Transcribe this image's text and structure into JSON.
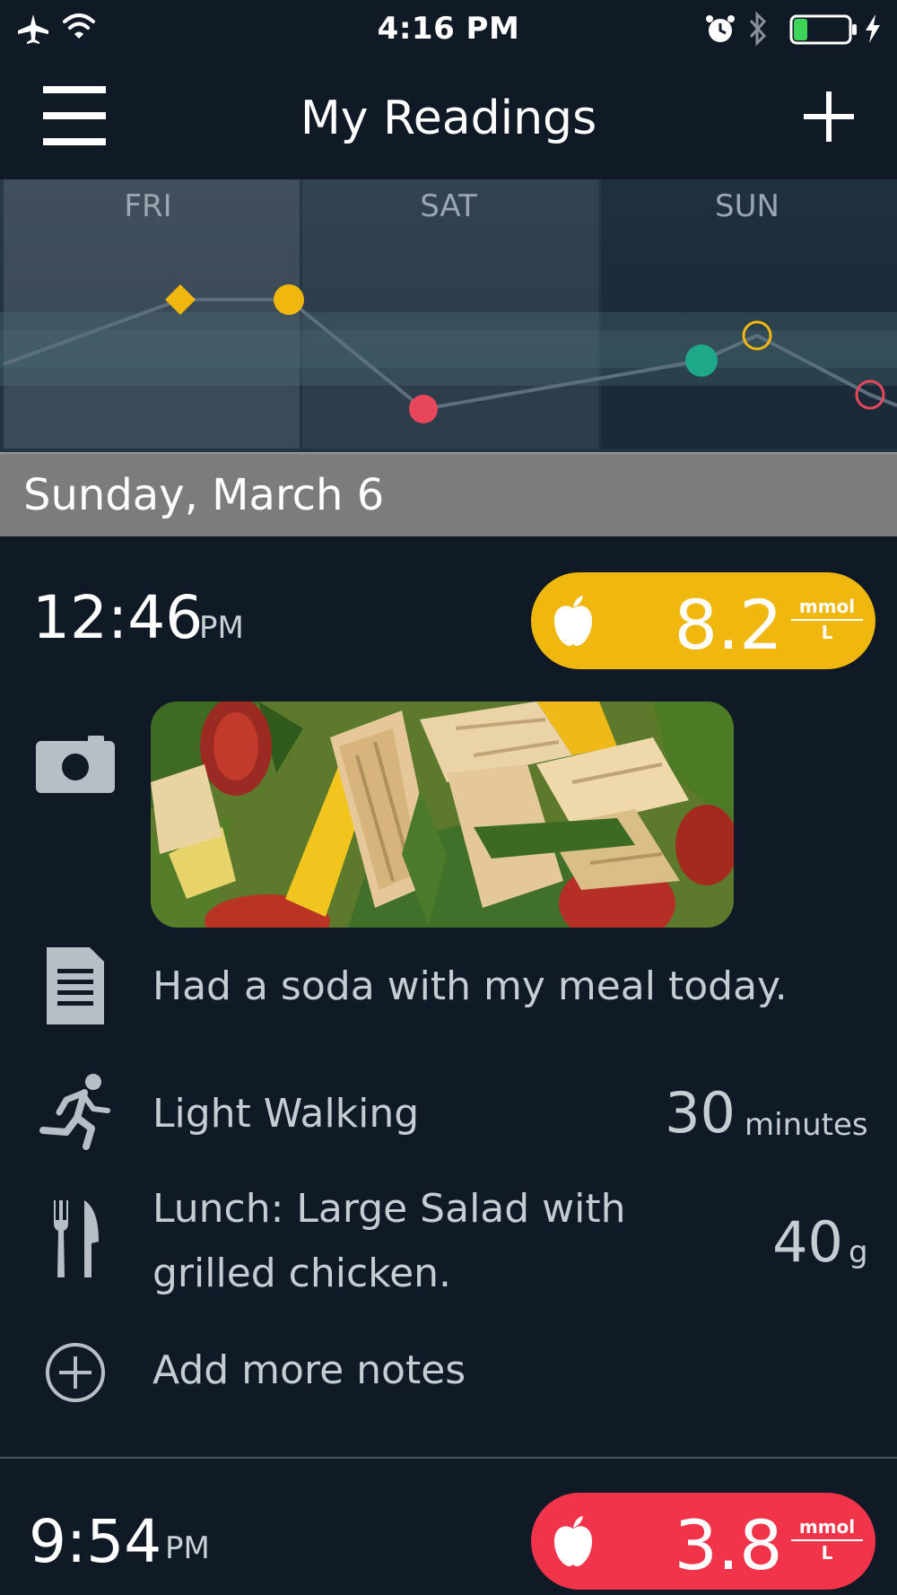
{
  "status_bar": {
    "time": "4:16 PM",
    "icons": [
      "airplane-icon",
      "wifi-icon",
      "alarm-icon",
      "bluetooth-icon",
      "battery-icon",
      "charging-bolt-icon"
    ],
    "battery_fill_fraction": 0.22
  },
  "nav": {
    "title": "My Readings",
    "menu_icon": "hamburger-menu-icon",
    "add_icon": "plus-icon"
  },
  "chart": {
    "days": [
      "FRI",
      "SAT",
      "SUN"
    ]
  },
  "date_header": "Sunday, March 6",
  "readings": [
    {
      "time": "12:46",
      "ampm": "PM",
      "badge_icon": "apple-icon",
      "value": "8.2",
      "unit_top": "mmol",
      "unit_bottom": "L",
      "color": "#f0b70e",
      "photo_icon": "camera-icon",
      "note_icon": "document-icon",
      "note": "Had a soda with my meal today.",
      "activity_icon": "running-icon",
      "activity": "Light Walking",
      "activity_value": "30",
      "activity_unit": "minutes",
      "meal_icon": "fork-knife-icon",
      "meal_line1": "Lunch: Large Salad with",
      "meal_line2": "grilled chicken.",
      "meal_value": "40",
      "meal_unit": "g",
      "add_icon": "plus-circle-icon",
      "add_label": "Add more notes"
    },
    {
      "time": "9:54",
      "ampm": "PM",
      "badge_icon": "apple-icon",
      "value": "3.8",
      "unit_top": "mmol",
      "unit_bottom": "L",
      "color": "#f1344a"
    }
  ],
  "colors": {
    "background": "#101a26",
    "chart_bg": "#233343",
    "date_header_bg": "#7c7c7c",
    "high": "#f0b70e",
    "low": "#f1344a",
    "in_range": "#1ea88a"
  }
}
